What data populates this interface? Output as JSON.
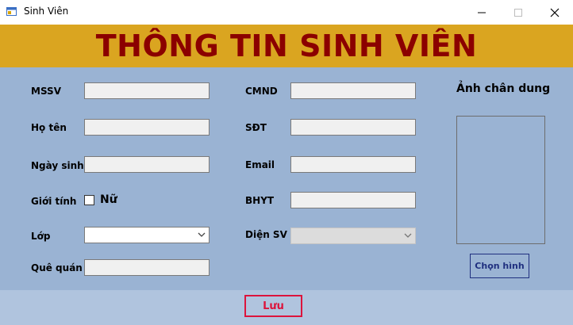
{
  "window": {
    "title": "Sinh Viên"
  },
  "banner": {
    "title": "THÔNG TIN SINH VIÊN"
  },
  "labels": {
    "mssv": "MSSV",
    "ho_ten": "Họ tên",
    "ngay_sinh": "Ngày sinh",
    "gioi_tinh": "Giới tính",
    "lop": "Lớp",
    "que_quan": "Quê quán",
    "cmnd": "CMND",
    "sdt": "SĐT",
    "email": "Email",
    "bhyt": "BHYT",
    "dien_sv": "Diện SV"
  },
  "gender_checkbox": {
    "label": "Nữ",
    "checked": false
  },
  "photo": {
    "title": "Ảnh chân dung",
    "choose_label": "Chọn hình"
  },
  "actions": {
    "save_label": "Lưu"
  },
  "colors": {
    "banner": "#daa520",
    "banner_text": "#8b0000",
    "form_bg": "#9ab3d3",
    "save": "#dc143c",
    "choose": "#1f2f7f"
  },
  "icons": {
    "app": "app-window-icon",
    "minimize": "minimize-icon",
    "maximize": "maximize-icon",
    "close": "close-icon",
    "dropdown": "chevron-down-icon"
  }
}
